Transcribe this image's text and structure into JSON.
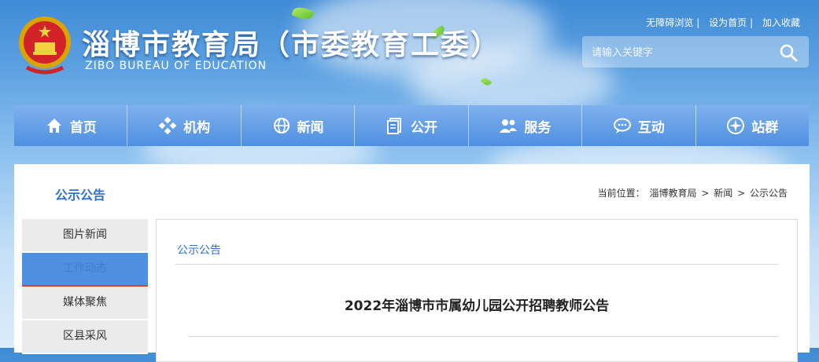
{
  "header": {
    "title_cn": "淄博市教育局（市委教育工委）",
    "title_en": "ZIBO BUREAU OF EDUCATION",
    "links": [
      "无障碍浏览",
      "设为首页",
      "加入收藏"
    ],
    "search_placeholder": "请输入关键字"
  },
  "nav": {
    "items": [
      {
        "label": "首页",
        "icon": "home-icon"
      },
      {
        "label": "机构",
        "icon": "org-icon"
      },
      {
        "label": "新闻",
        "icon": "globe-icon"
      },
      {
        "label": "公开",
        "icon": "document-icon"
      },
      {
        "label": "服务",
        "icon": "users-icon"
      },
      {
        "label": "互动",
        "icon": "chat-icon"
      },
      {
        "label": "站群",
        "icon": "compass-icon"
      }
    ]
  },
  "section": {
    "title": "公示公告",
    "breadcrumb": [
      "当前位置：",
      "淄博教育局",
      ">",
      "新闻",
      ">",
      "公示公告"
    ]
  },
  "sidebar": {
    "items": [
      {
        "label": "图片新闻",
        "active": false
      },
      {
        "label": "工作动态",
        "active": true
      },
      {
        "label": "媒体聚焦",
        "active": false
      },
      {
        "label": "区县采风",
        "active": false
      }
    ]
  },
  "content": {
    "heading": "公示公告",
    "article_title": "2022年淄博市市属幼儿园公开招聘教师公告"
  },
  "colors": {
    "accent": "#2f6ed8",
    "nav": "#4f8fe0",
    "active_sidebar": "#4f8fe0"
  }
}
